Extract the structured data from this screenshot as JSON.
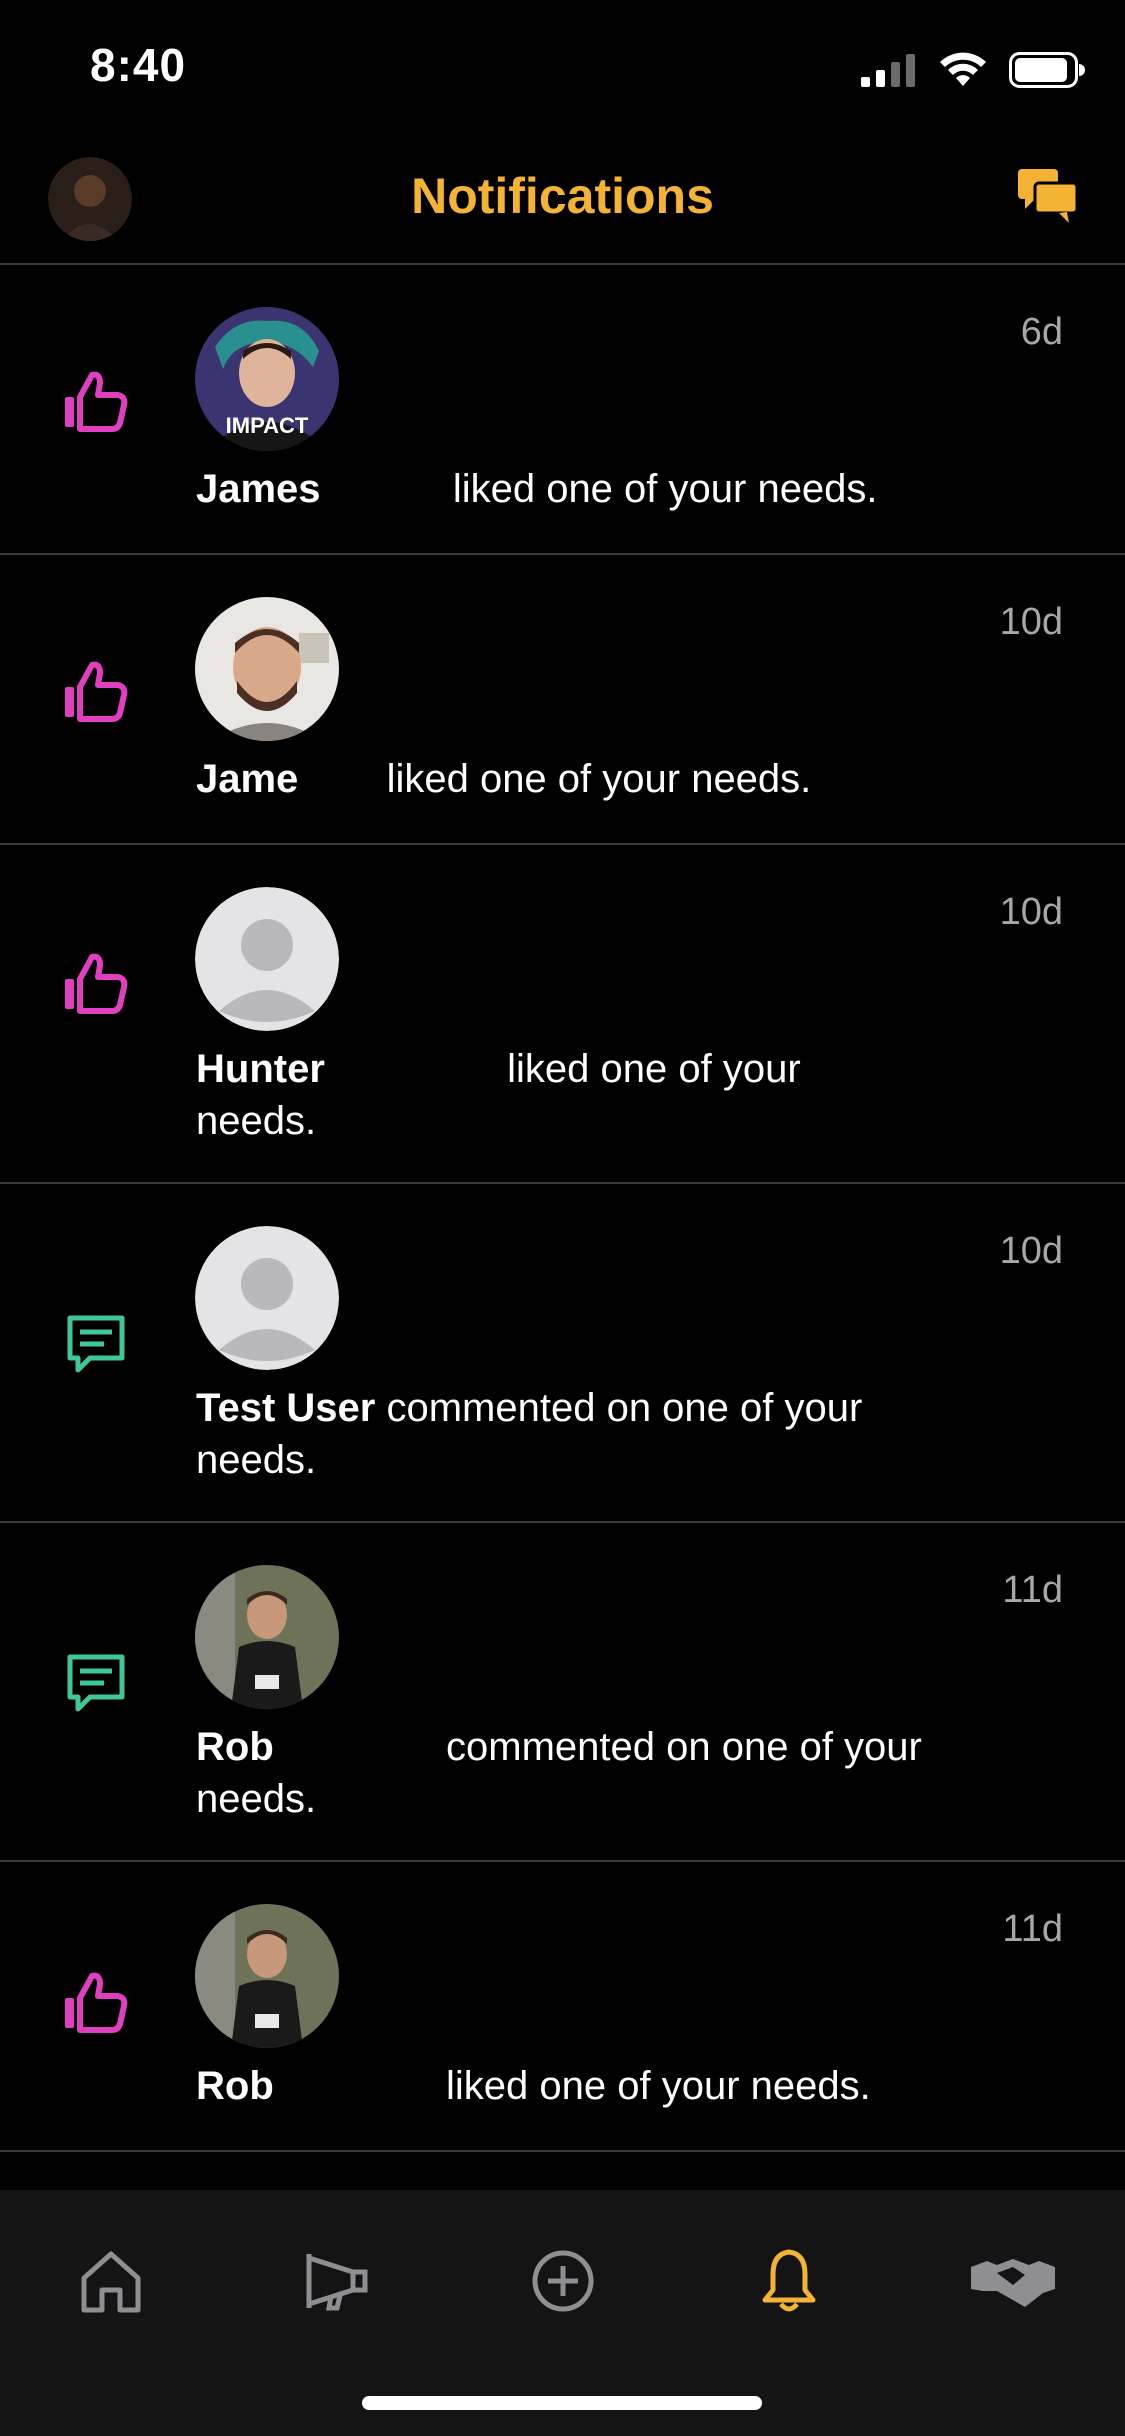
{
  "status": {
    "time": "8:40"
  },
  "header": {
    "title": "Notifications"
  },
  "colors": {
    "accent": "#f5b335",
    "like": "#e040c0",
    "comment": "#3fc79a",
    "divider": "#3a3a3c",
    "tab_bar": "#141414"
  },
  "notifications": [
    {
      "type": "like",
      "icon": "thumbs-up-icon",
      "name": "James",
      "text": "liked one of your needs.",
      "time": "6d"
    },
    {
      "type": "like",
      "icon": "thumbs-up-icon",
      "name": "Jame",
      "text": "liked one of your needs.",
      "time": "10d"
    },
    {
      "type": "like",
      "icon": "thumbs-up-icon",
      "name": "Hunter",
      "text": "liked one of your needs.",
      "time": "10d"
    },
    {
      "type": "comment",
      "icon": "comment-icon",
      "name": "Test User",
      "text": "commented on one of your needs.",
      "time": "10d"
    },
    {
      "type": "comment",
      "icon": "comment-icon",
      "name": "Rob",
      "text": "commented on one of your needs.",
      "time": "11d"
    },
    {
      "type": "like",
      "icon": "thumbs-up-icon",
      "name": "Rob",
      "text": "liked one of your needs.",
      "time": "11d"
    }
  ],
  "tabs": [
    {
      "icon": "home-icon",
      "active": false
    },
    {
      "icon": "megaphone-icon",
      "active": false
    },
    {
      "icon": "add-circle-icon",
      "active": false
    },
    {
      "icon": "bell-icon",
      "active": true
    },
    {
      "icon": "handshake-icon",
      "active": false
    }
  ]
}
